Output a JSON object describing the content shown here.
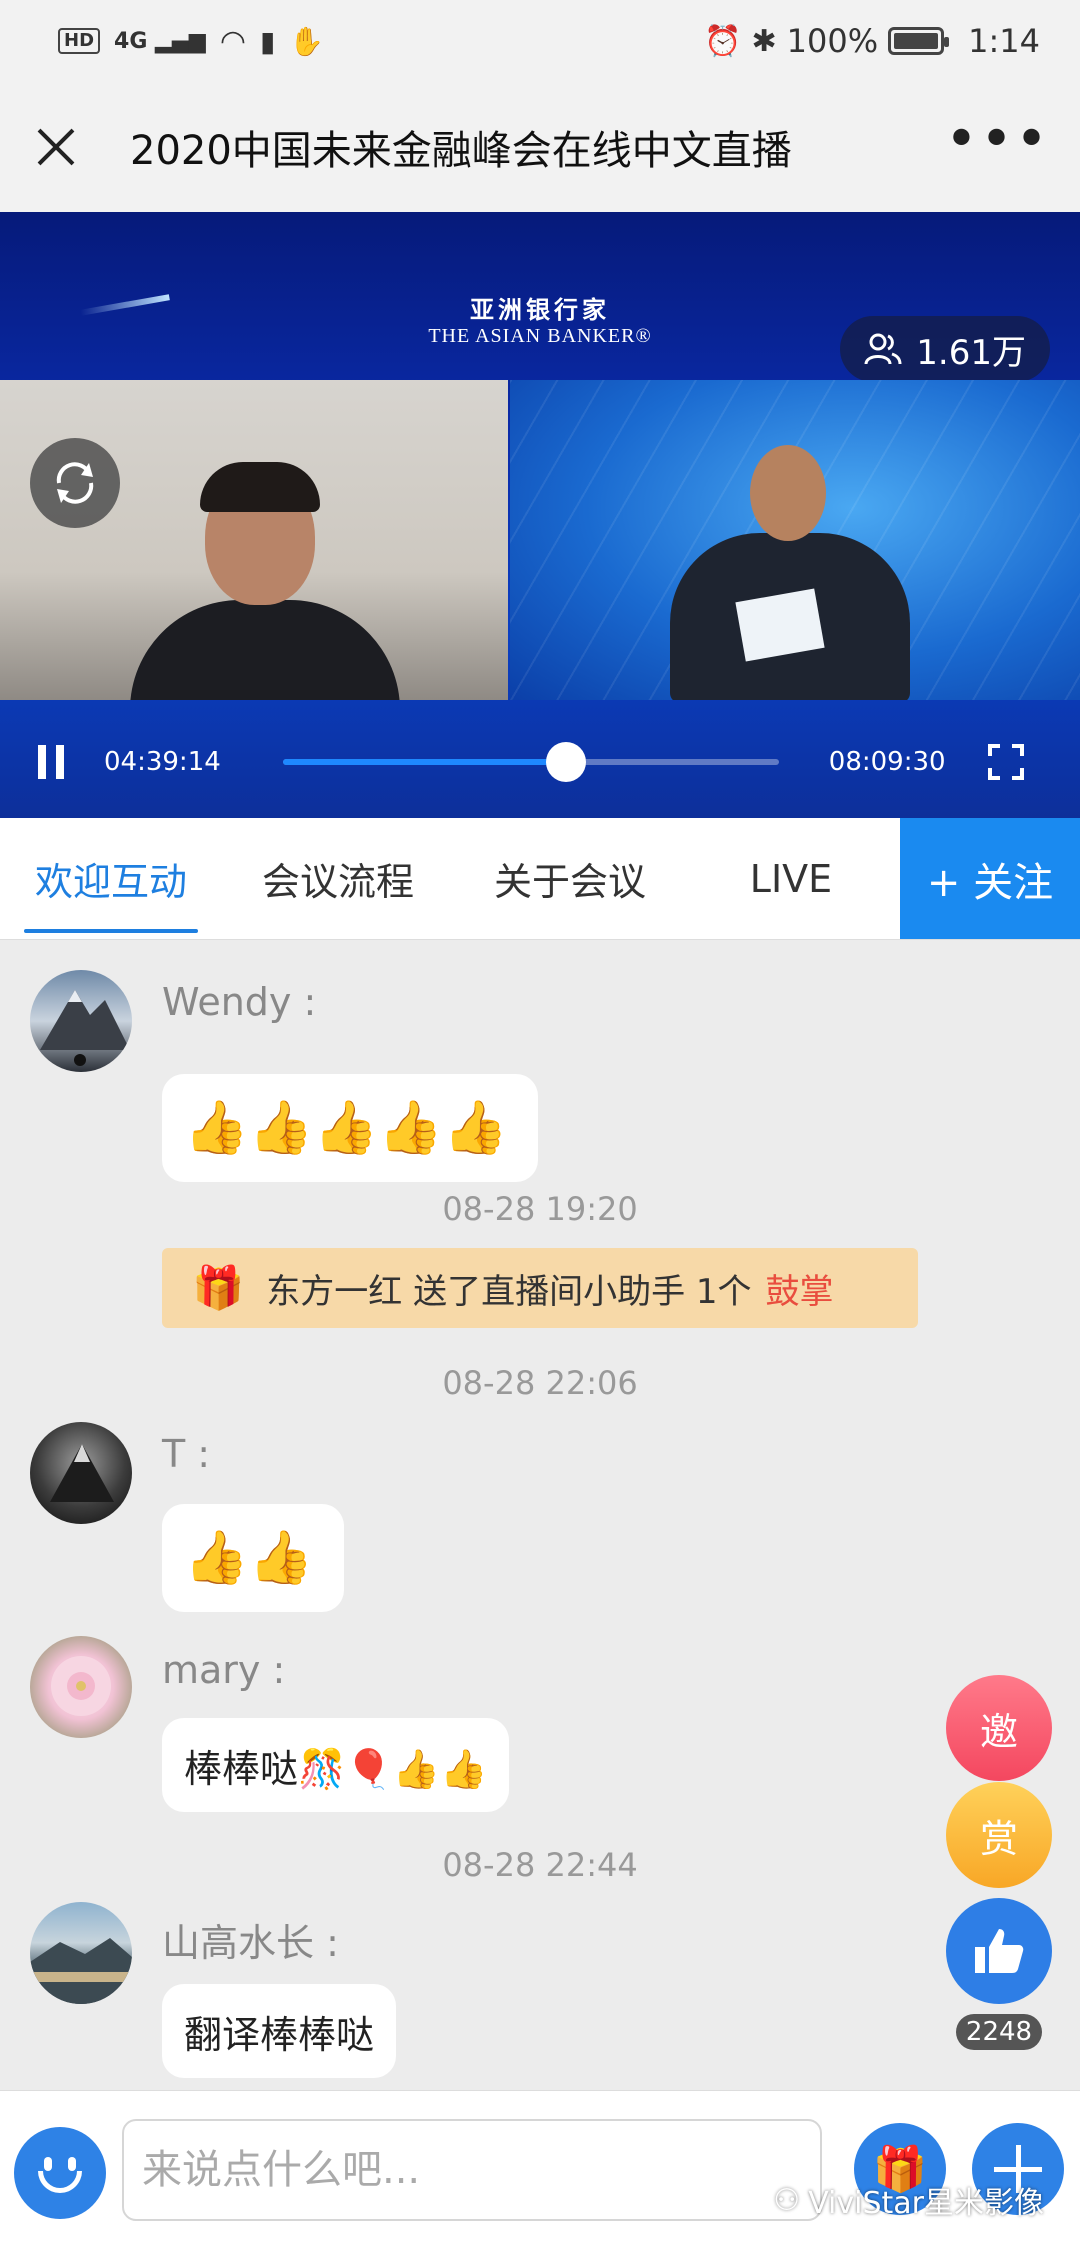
{
  "status_bar": {
    "network": "HD",
    "signal": "4G",
    "battery": "100%",
    "time": "1:14"
  },
  "header": {
    "title": "2020中国未来金融峰会在线中文直播"
  },
  "video": {
    "brand_cn": "亚洲银行家",
    "brand_en": "THE ASIAN BANKER®",
    "viewers": "1.61万",
    "current_time": "04:39:14",
    "duration": "08:09:30",
    "progress": 0.57
  },
  "tabs": [
    {
      "label": "欢迎互动",
      "active": true
    },
    {
      "label": "会议流程",
      "active": false
    },
    {
      "label": "关于会议",
      "active": false
    },
    {
      "label": "LIVE",
      "active": false
    }
  ],
  "follow_button": "+ 关注",
  "chat": {
    "messages": [
      {
        "user": "Wendy :",
        "text": "👍👍👍👍👍"
      },
      {
        "timestamp": "08-28 19:20"
      },
      {
        "gift": {
          "text": "东方一红 送了直播间小助手 1个",
          "item": "鼓掌"
        }
      },
      {
        "timestamp": "08-28 22:06"
      },
      {
        "user": "T :",
        "text": "👍👍"
      },
      {
        "user": "mary :",
        "text": "棒棒哒🎊🎈👍👍"
      },
      {
        "timestamp": "08-28 22:44"
      },
      {
        "user": "山高水长 :",
        "text": "翻译棒棒哒"
      }
    ]
  },
  "floating": {
    "invite": "邀",
    "reward": "赏",
    "like_count": "2248"
  },
  "input": {
    "placeholder": "来说点什么吧..."
  },
  "watermark": "ViviStar星米影像"
}
